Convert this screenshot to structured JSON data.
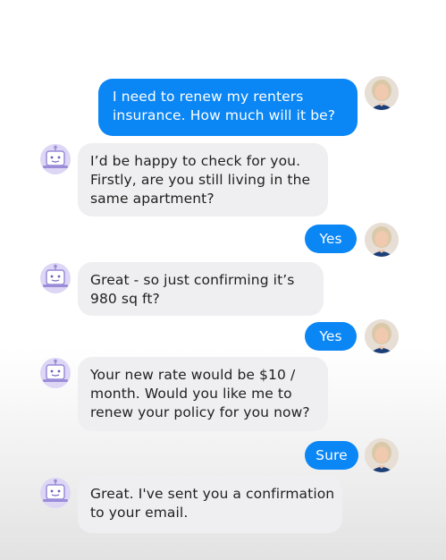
{
  "colors": {
    "user_bubble": "#0a86f5",
    "bot_bubble": "#efeff1",
    "bot_icon_accent": "#a99be0",
    "bot_icon_bg": "#ddd6f5"
  },
  "icons": {
    "bot": "robot-icon",
    "user": "user-avatar-photo"
  },
  "messages": [
    {
      "sender": "user",
      "lines": [
        "I need to renew my renters",
        "insurance. How much will it be?"
      ]
    },
    {
      "sender": "bot",
      "lines": [
        "I’d be happy to check for you.",
        "Firstly, are you still living in the",
        "same apartment?"
      ]
    },
    {
      "sender": "user",
      "lines": [
        "Yes"
      ]
    },
    {
      "sender": "bot",
      "lines": [
        "Great - so just confirming it’s",
        "980 sq ft?"
      ]
    },
    {
      "sender": "user",
      "lines": [
        "Yes"
      ]
    },
    {
      "sender": "bot",
      "lines": [
        "Your new rate would be $10 /",
        "month. Would you like me to",
        "renew your policy for you now?"
      ]
    },
    {
      "sender": "user",
      "lines": [
        "Sure"
      ]
    },
    {
      "sender": "bot",
      "lines": [
        "Great. I've sent you a confirmation",
        "to your email."
      ]
    }
  ]
}
